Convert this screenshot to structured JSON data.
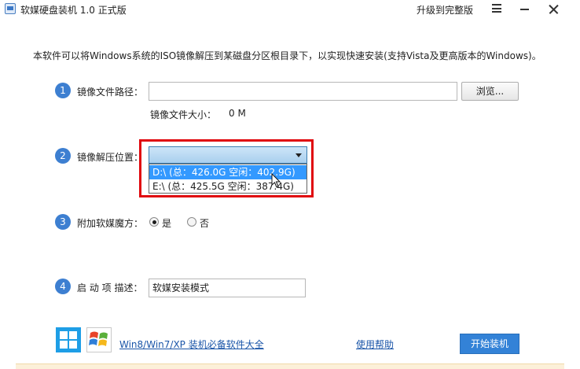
{
  "window": {
    "title": "软媒硬盘装机 1.0 正式版",
    "upgrade_label": "升级到完整版"
  },
  "description": "本软件可以将Windows系统的ISO镜像解压到某磁盘分区根目录下，以实现快速安装(支持Vista及更高版本的Windows)。",
  "steps": {
    "s1": {
      "number": "1",
      "label": "镜像文件路径：",
      "value": "",
      "browse_label": "浏览...",
      "size_label": "镜像文件大小：",
      "size_value": "0 M"
    },
    "s2": {
      "number": "2",
      "label": "镜像解压位置：",
      "selected": "",
      "options": [
        "D:\\ (总：426.0G 空闲：402.9G)",
        "E:\\ (总：425.5G 空闲：387.4G)"
      ]
    },
    "s3": {
      "number": "3",
      "label": "附加软媒魔方：",
      "yes_label": "是",
      "no_label": "否",
      "selected": "yes"
    },
    "s4": {
      "number": "4",
      "label": "启 动 项 描述：",
      "value": "软媒安装模式"
    }
  },
  "footer": {
    "software_link": "Win8/Win7/XP 装机必备软件大全",
    "help_link": "使用帮助",
    "start_label": "开始装机"
  },
  "colors": {
    "accent": "#3d7fd1",
    "highlight_border": "#e0070d",
    "selection": "#3399ff"
  }
}
